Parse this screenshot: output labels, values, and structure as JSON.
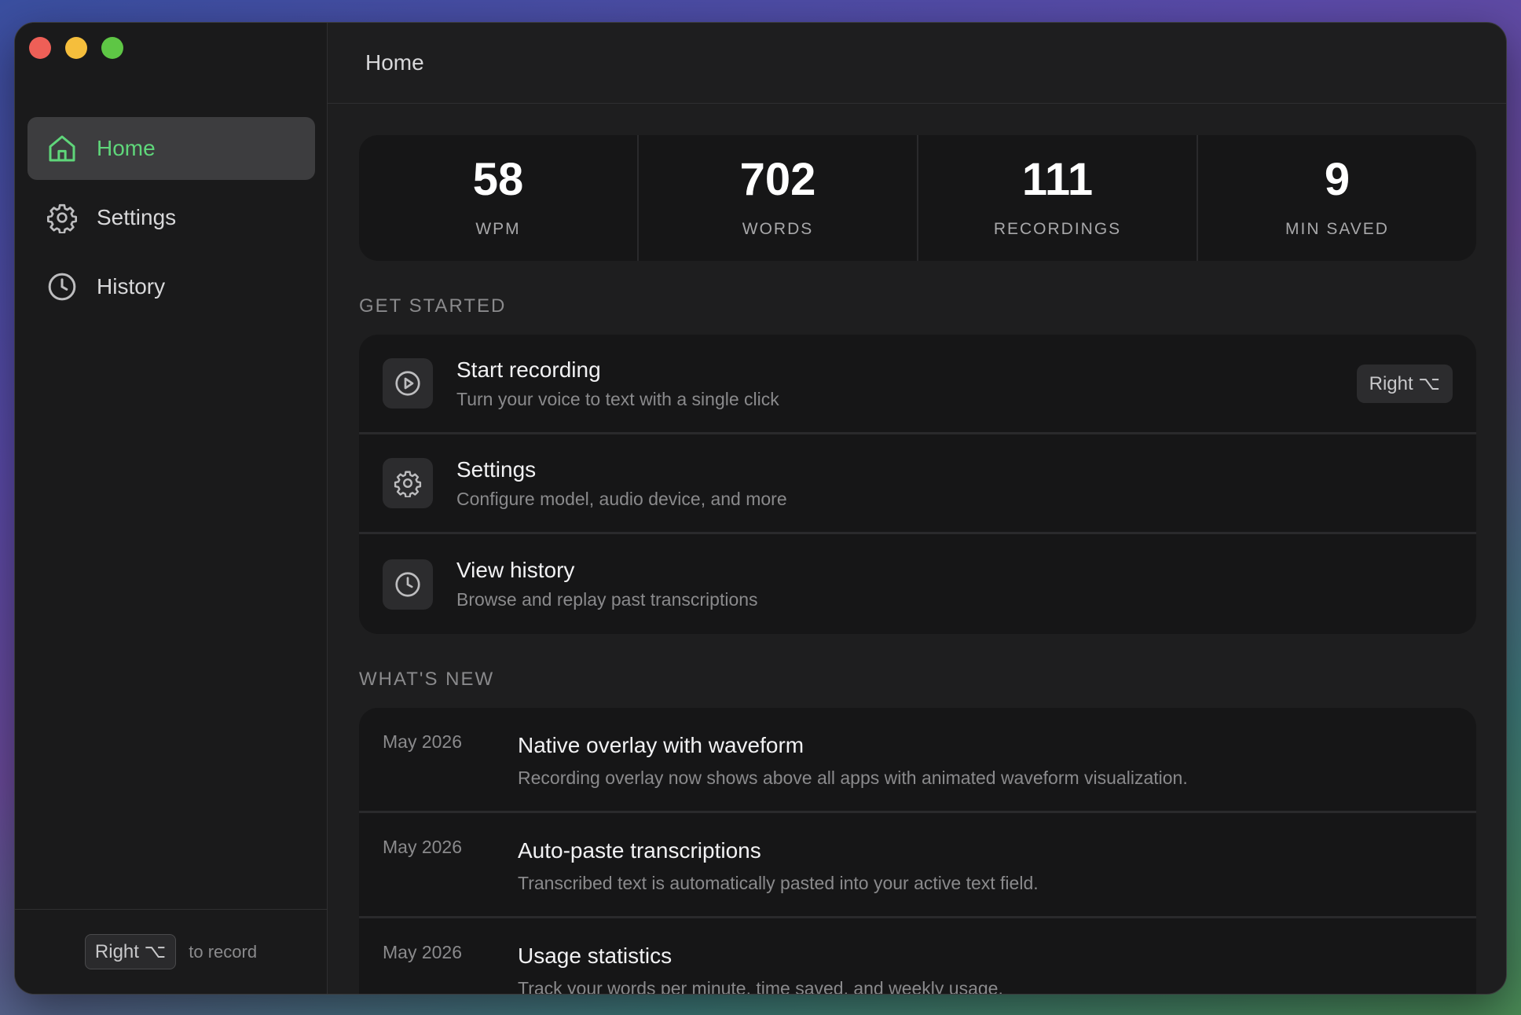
{
  "sidebar": {
    "nav": [
      {
        "label": "Home",
        "icon": "home-icon",
        "active": true
      },
      {
        "label": "Settings",
        "icon": "gear-icon",
        "active": false
      },
      {
        "label": "History",
        "icon": "clock-icon",
        "active": false
      }
    ],
    "footer": {
      "shortcut": "Right ⌥",
      "text": "to record"
    }
  },
  "header": {
    "title": "Home"
  },
  "stats": [
    {
      "value": "58",
      "label": "WPM"
    },
    {
      "value": "702",
      "label": "WORDS"
    },
    {
      "value": "111",
      "label": "RECORDINGS"
    },
    {
      "value": "9",
      "label": "MIN SAVED"
    }
  ],
  "get_started": {
    "title": "GET STARTED",
    "items": [
      {
        "title": "Start recording",
        "desc": "Turn your voice to text with a single click",
        "shortcut": "Right ⌥",
        "icon": "play-icon"
      },
      {
        "title": "Settings",
        "desc": "Configure model, audio device, and more",
        "icon": "gear-icon"
      },
      {
        "title": "View history",
        "desc": "Browse and replay past transcriptions",
        "icon": "clock-icon"
      }
    ]
  },
  "whats_new": {
    "title": "WHAT'S NEW",
    "items": [
      {
        "date": "May 2026",
        "title": "Native overlay with waveform",
        "desc": "Recording overlay now shows above all apps with animated waveform visualization."
      },
      {
        "date": "May 2026",
        "title": "Auto-paste transcriptions",
        "desc": "Transcribed text is automatically pasted into your active text field."
      },
      {
        "date": "May 2026",
        "title": "Usage statistics",
        "desc": "Track your words per minute, time saved, and weekly usage."
      }
    ]
  },
  "colors": {
    "accent": "#5fd67a",
    "background": "#1e1e1f",
    "card": "#161617"
  }
}
